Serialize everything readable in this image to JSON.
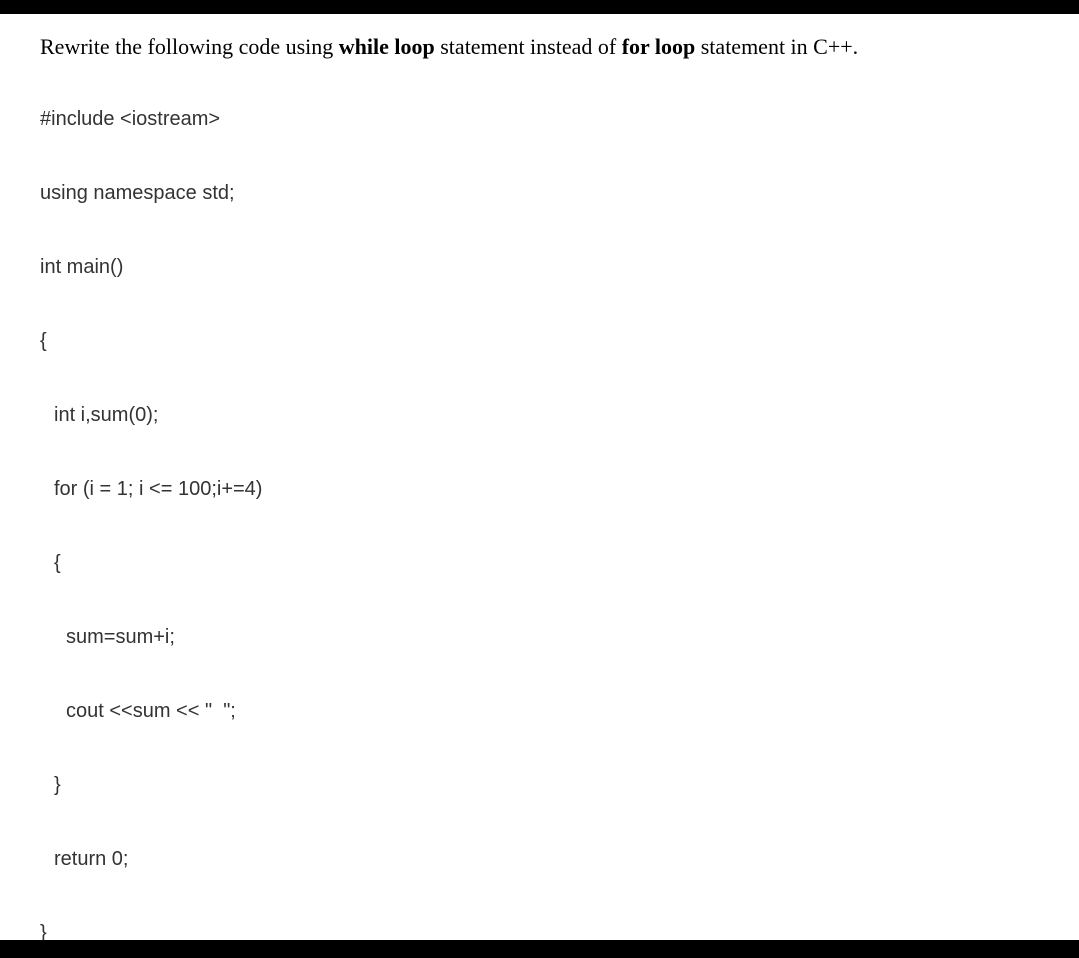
{
  "question": {
    "prefix": "Rewrite the following code using ",
    "b1": "while loop",
    "mid": " statement instead of ",
    "b2": "for loop",
    "suffix": " statement in C++."
  },
  "code": {
    "l1": "#include <iostream>",
    "l2": "using namespace std;",
    "l3": "int main()",
    "l4": "{",
    "l5": "int i,sum(0);",
    "l6": "for (i = 1; i <= 100;i+=4)",
    "l7": "{",
    "l8": "sum=sum+i;",
    "l9": "cout <<sum << \"  \";",
    "l10": "}",
    "l11": "return 0;",
    "l12": "}"
  }
}
